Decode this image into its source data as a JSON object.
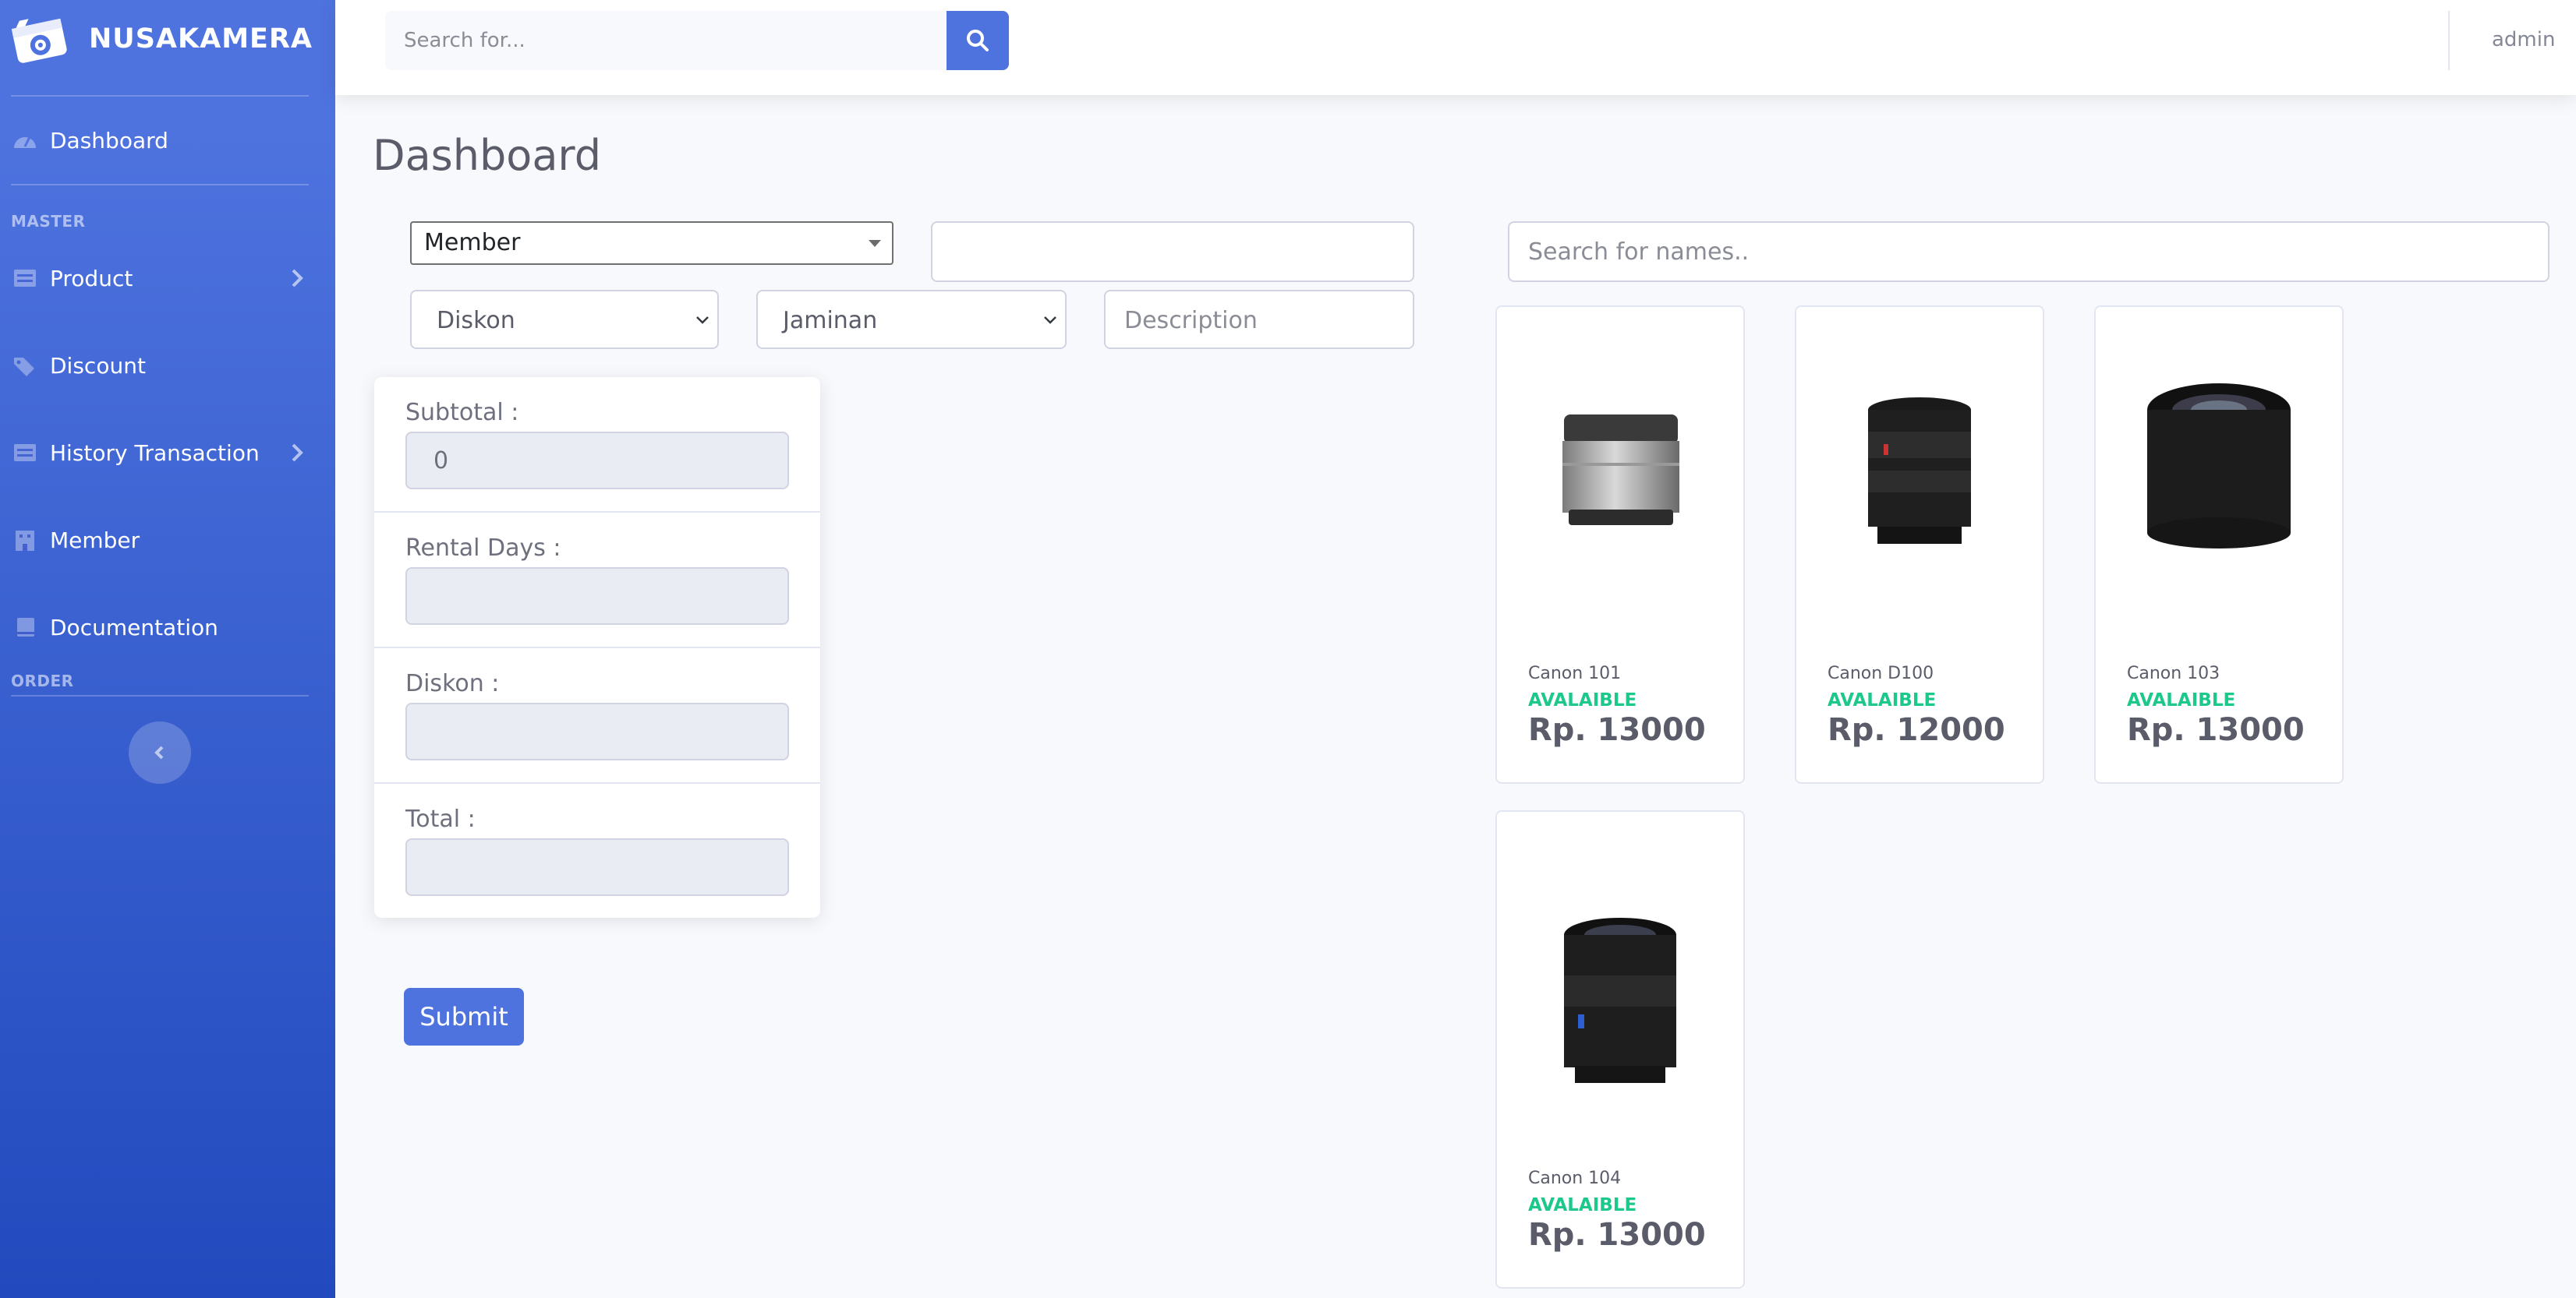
{
  "brand": {
    "name": "NUSAKAMERA",
    "logo_icon": "camera-icon"
  },
  "sidebar": {
    "items": [
      {
        "label": "Dashboard",
        "icon": "tachometer-icon"
      },
      {
        "label": "Product",
        "icon": "table-icon",
        "has_submenu": true
      },
      {
        "label": "Discount",
        "icon": "tags-icon"
      },
      {
        "label": "History Transaction",
        "icon": "table-icon",
        "has_submenu": true
      },
      {
        "label": "Member",
        "icon": "building-icon"
      },
      {
        "label": "Documentation",
        "icon": "book-icon"
      }
    ],
    "headings": {
      "master": "MASTER",
      "order": "ORDER"
    },
    "toggle_icon": "angle-left-icon"
  },
  "topbar": {
    "search_placeholder": "Search for...",
    "search_icon": "search-icon",
    "user": "admin"
  },
  "page": {
    "title": "Dashboard"
  },
  "form": {
    "member_select": "Member",
    "member_value": "",
    "diskon_select": "Diskon",
    "jaminan_select": "Jaminan",
    "description_placeholder": "Description"
  },
  "summary": {
    "subtotal_label": "Subtotal :",
    "subtotal_value": "0",
    "rental_days_label": "Rental Days :",
    "rental_days_value": "",
    "diskon_label": "Diskon :",
    "diskon_value": "",
    "total_label": "Total :",
    "total_value": ""
  },
  "submit_label": "Submit",
  "product_search_placeholder": "Search for names..",
  "products": [
    {
      "name": "Canon 101",
      "status": "AVALAIBLE",
      "price": "Rp. 13000"
    },
    {
      "name": "Canon D100",
      "status": "AVALAIBLE",
      "price": "Rp. 12000"
    },
    {
      "name": "Canon 103",
      "status": "AVALAIBLE",
      "price": "Rp. 13000"
    },
    {
      "name": "Canon 104",
      "status": "AVALAIBLE",
      "price": "Rp. 13000"
    }
  ],
  "colors": {
    "primary": "#4e73df",
    "success": "#1cc88a",
    "text": "#5a5c69"
  }
}
